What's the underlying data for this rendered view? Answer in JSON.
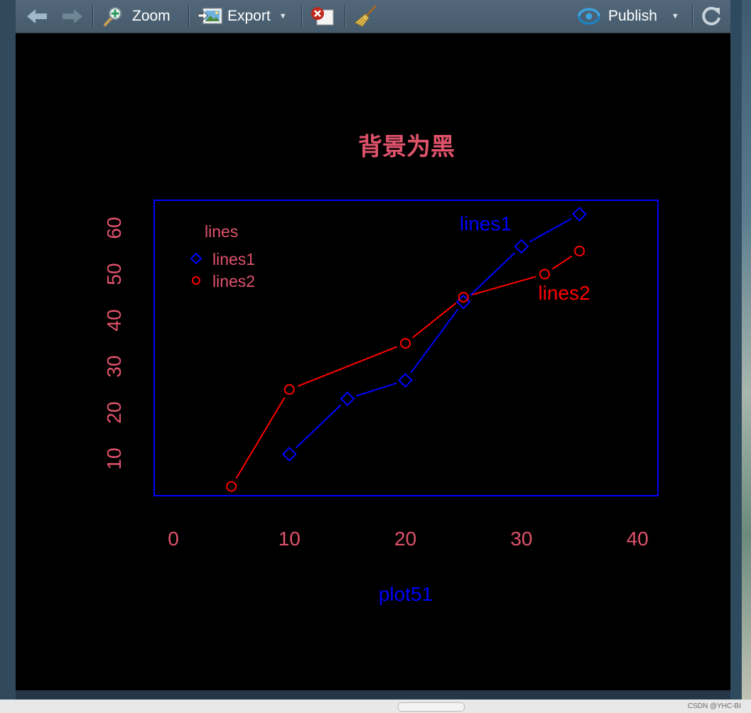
{
  "toolbar": {
    "zoom_label": "Zoom",
    "export_label": "Export",
    "publish_label": "Publish"
  },
  "watermark": "CSDN @YHC-BI",
  "colors": {
    "background": "#000000",
    "box": "#0000ff",
    "axis_text": "#df536b",
    "lines1": "#0000ff",
    "lines2": "#ff0000",
    "title": "#df536b",
    "xlabel": "#0000ff"
  },
  "chart_data": {
    "type": "line",
    "title": "背景为黑",
    "xlabel": "plot51",
    "ylabel": "",
    "xlim": [
      0,
      40
    ],
    "ylim": [
      2,
      66
    ],
    "x_ticks": [
      "0",
      "10",
      "20",
      "30",
      "40"
    ],
    "y_ticks": [
      "10",
      "20",
      "30",
      "40",
      "50",
      "60"
    ],
    "grid": false,
    "legend": {
      "title": "lines",
      "placement": "top-left",
      "entries": [
        "lines1",
        "lines2"
      ]
    },
    "series": [
      {
        "name": "lines1",
        "marker": "diamond",
        "x": [
          10,
          15,
          20,
          25,
          30,
          35
        ],
        "y": [
          11,
          23,
          27,
          44,
          56,
          63
        ]
      },
      {
        "name": "lines2",
        "marker": "circle",
        "x": [
          5,
          10,
          20,
          25,
          32,
          35
        ],
        "y": [
          4,
          25,
          35,
          45,
          50,
          55
        ]
      }
    ],
    "annotations": [
      {
        "text": "lines1",
        "x": 27,
        "y": 61,
        "color": "#0000ff"
      },
      {
        "text": "lines2",
        "x": 35,
        "y": 46,
        "color": "#ff0000"
      }
    ]
  }
}
